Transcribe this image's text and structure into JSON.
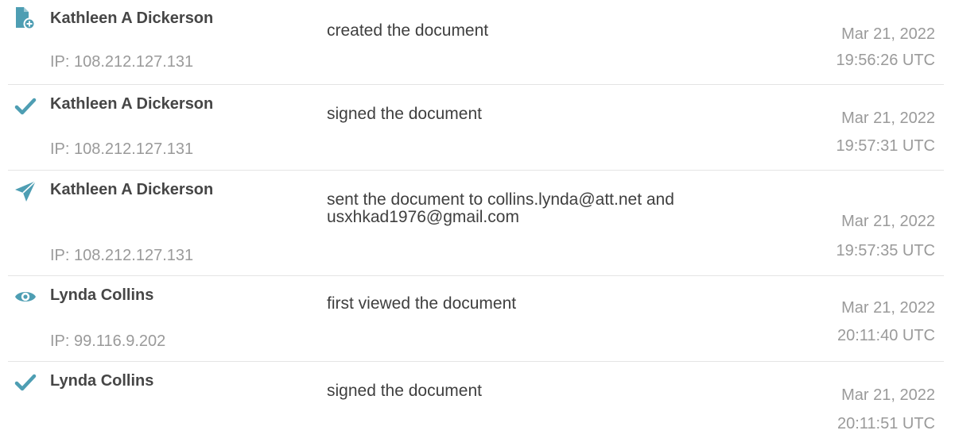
{
  "colors": {
    "icon_accent": "#4e9eb3",
    "actor_text": "#464646",
    "muted_text": "#9a9a9a",
    "divider": "#e4e4e4"
  },
  "events": [
    {
      "icon": "document-add-icon",
      "actor": "Kathleen A Dickerson",
      "ip": "IP: 108.212.127.131",
      "action": "created the document",
      "date": "Mar 21, 2022",
      "time": "19:56:26 UTC"
    },
    {
      "icon": "checkmark-icon",
      "actor": "Kathleen A Dickerson",
      "ip": "IP: 108.212.127.131",
      "action": "signed the document",
      "date": "Mar 21, 2022",
      "time": "19:57:31 UTC"
    },
    {
      "icon": "paper-plane-icon",
      "actor": "Kathleen A Dickerson",
      "ip": "IP: 108.212.127.131",
      "action": "sent the document to collins.lynda@att.net and usxhkad1976@gmail.com",
      "date": "Mar 21, 2022",
      "time": "19:57:35 UTC"
    },
    {
      "icon": "eye-icon",
      "actor": "Lynda Collins",
      "ip": "IP: 99.116.9.202",
      "action": "first viewed the document",
      "date": "Mar 21, 2022",
      "time": "20:11:40 UTC"
    },
    {
      "icon": "checkmark-icon",
      "actor": "Lynda Collins",
      "ip": "",
      "action": "signed the document",
      "date": "Mar 21, 2022",
      "time": "20:11:51 UTC"
    }
  ]
}
